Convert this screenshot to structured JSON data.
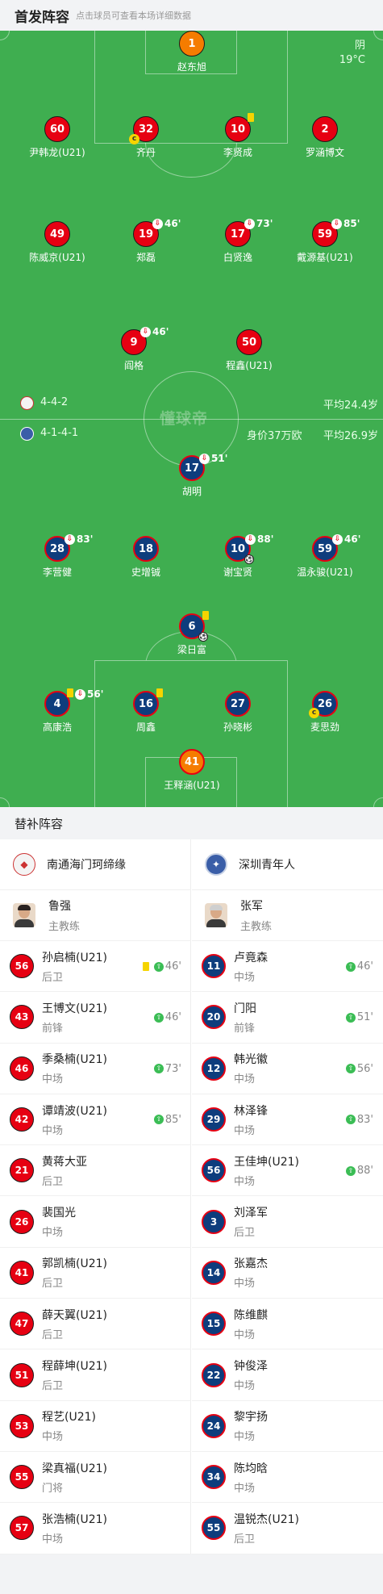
{
  "header": {
    "title": "首发阵容",
    "hint": "点击球员可查看本场详细数据"
  },
  "weather": {
    "condition": "阴",
    "temp": "19°C"
  },
  "watermark": "懂球帝",
  "home_info": {
    "formation": "4-4-2",
    "avg_age": "平均24.4岁"
  },
  "away_info": {
    "formation": "4-1-4-1",
    "value": "身价37万欧",
    "avg_age": "平均26.9岁"
  },
  "home_players": [
    {
      "num": "1",
      "name": "赵东旭"
    },
    {
      "num": "60",
      "name": "尹韩龙(U21)"
    },
    {
      "num": "32",
      "name": "齐丹"
    },
    {
      "num": "10",
      "name": "李贤成"
    },
    {
      "num": "2",
      "name": "罗涵博文"
    },
    {
      "num": "49",
      "name": "陈威京(U21)"
    },
    {
      "num": "19",
      "name": "郑磊",
      "sub": "46'"
    },
    {
      "num": "17",
      "name": "白贤逸",
      "sub": "73'"
    },
    {
      "num": "59",
      "name": "戴源基(U21)",
      "sub": "85'"
    },
    {
      "num": "9",
      "name": "阎格",
      "sub": "46'"
    },
    {
      "num": "50",
      "name": "程鑫(U21)"
    }
  ],
  "away_players": [
    {
      "num": "17",
      "name": "胡明",
      "sub": "51'"
    },
    {
      "num": "28",
      "name": "李营健",
      "sub": "83'"
    },
    {
      "num": "18",
      "name": "史增铖"
    },
    {
      "num": "10",
      "name": "谢宝贤",
      "sub": "88'"
    },
    {
      "num": "59",
      "name": "温永骏(U21)",
      "sub": "46'"
    },
    {
      "num": "6",
      "name": "梁日富"
    },
    {
      "num": "4",
      "name": "高康浩",
      "sub": "56'"
    },
    {
      "num": "16",
      "name": "周鑫"
    },
    {
      "num": "27",
      "name": "孙晓彬"
    },
    {
      "num": "26",
      "name": "麦思劲"
    },
    {
      "num": "41",
      "name": "王释涵(U21)"
    }
  ],
  "subs_title": "替补阵容",
  "home_team": {
    "name": "南通海门珂缔缘",
    "coach": "鲁强",
    "coach_role": "主教练"
  },
  "away_team": {
    "name": "深圳青年人",
    "coach": "张军",
    "coach_role": "主教练"
  },
  "home_subs": [
    {
      "num": "56",
      "name": "孙启楠(U21)",
      "pos": "后卫",
      "in": "46'"
    },
    {
      "num": "43",
      "name": "王博文(U21)",
      "pos": "前锋",
      "in": "46'"
    },
    {
      "num": "46",
      "name": "季桑楠(U21)",
      "pos": "中场",
      "in": "73'"
    },
    {
      "num": "42",
      "name": "谭靖波(U21)",
      "pos": "中场",
      "in": "85'"
    },
    {
      "num": "21",
      "name": "黄蒋大亚",
      "pos": "后卫"
    },
    {
      "num": "26",
      "name": "裴国光",
      "pos": "中场"
    },
    {
      "num": "41",
      "name": "郭凯楠(U21)",
      "pos": "后卫"
    },
    {
      "num": "47",
      "name": "薛天翼(U21)",
      "pos": "后卫"
    },
    {
      "num": "51",
      "name": "程薛坤(U21)",
      "pos": "后卫"
    },
    {
      "num": "53",
      "name": "程艺(U21)",
      "pos": "中场"
    },
    {
      "num": "55",
      "name": "梁真福(U21)",
      "pos": "门将"
    },
    {
      "num": "57",
      "name": "张浩楠(U21)",
      "pos": "中场"
    }
  ],
  "away_subs": [
    {
      "num": "11",
      "name": "卢竟森",
      "pos": "中场",
      "in": "46'"
    },
    {
      "num": "20",
      "name": "门阳",
      "pos": "前锋",
      "in": "51'"
    },
    {
      "num": "12",
      "name": "韩光徽",
      "pos": "中场",
      "in": "56'"
    },
    {
      "num": "29",
      "name": "林泽锋",
      "pos": "中场",
      "in": "83'"
    },
    {
      "num": "56",
      "name": "王佳坤(U21)",
      "pos": "中场",
      "in": "88'"
    },
    {
      "num": "3",
      "name": "刘泽军",
      "pos": "后卫"
    },
    {
      "num": "14",
      "name": "张嘉杰",
      "pos": "中场"
    },
    {
      "num": "15",
      "name": "陈维麒",
      "pos": "中场"
    },
    {
      "num": "22",
      "name": "钟俊泽",
      "pos": "中场"
    },
    {
      "num": "24",
      "name": "黎宇扬",
      "pos": "中场"
    },
    {
      "num": "34",
      "name": "陈均晗",
      "pos": "中场"
    },
    {
      "num": "55",
      "name": "温锐杰(U21)",
      "pos": "后卫"
    }
  ],
  "colors": {
    "pitch": "#3fae50",
    "home": "#e60012",
    "away": "#0e3d7d",
    "keeper": "#f57c00"
  }
}
